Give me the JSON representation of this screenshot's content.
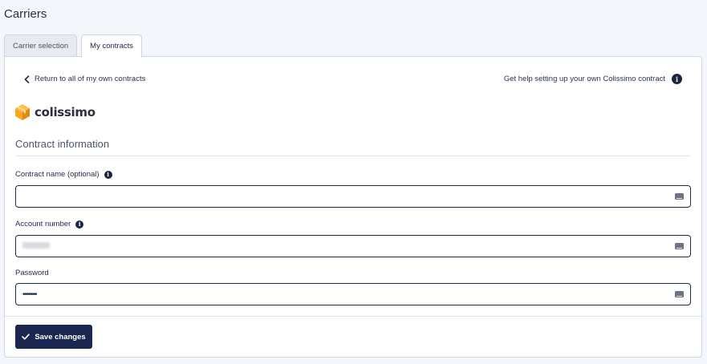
{
  "page": {
    "title": "Carriers"
  },
  "tabs": [
    {
      "label": "Carrier selection",
      "active": false
    },
    {
      "label": "My contracts",
      "active": true
    }
  ],
  "links": {
    "back": "Return to all of my own contracts",
    "help": "Get help setting up your own Colissimo contract"
  },
  "carrier": {
    "logo_text": "colissimo",
    "brand_color": "#f7a823"
  },
  "section": {
    "title": "Contract information"
  },
  "fields": {
    "contract_name": {
      "label": "Contract name (optional)",
      "value": ""
    },
    "account_number": {
      "label": "Account number",
      "value": ""
    },
    "password": {
      "label": "Password",
      "value": "•••••••"
    }
  },
  "actions": {
    "save_label": "Save changes"
  },
  "colors": {
    "primary": "#1a2650",
    "border": "#cfd6e2",
    "background": "#f3f6fb"
  }
}
